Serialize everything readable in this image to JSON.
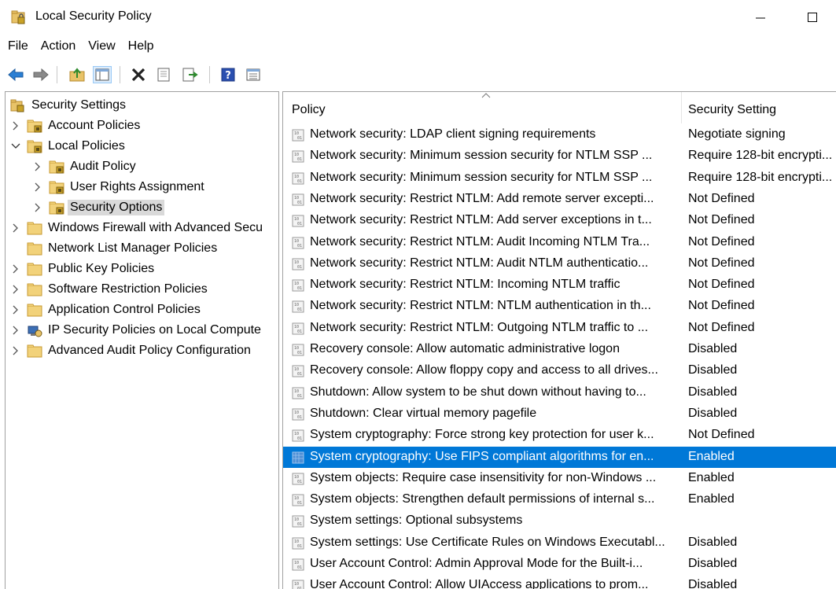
{
  "window": {
    "title": "Local Security Policy"
  },
  "menu": [
    "File",
    "Action",
    "View",
    "Help"
  ],
  "toolbar": {
    "buttons": [
      "back-icon",
      "forward-icon",
      "up-folder-icon",
      "show-hide-tree-icon",
      "delete-icon",
      "properties-icon",
      "export-list-icon",
      "help-icon",
      "view-icon"
    ]
  },
  "tree": {
    "root": "Security Settings",
    "nodes": [
      {
        "label": "Account Policies",
        "level": 1,
        "expander": "collapsed"
      },
      {
        "label": "Local Policies",
        "level": 1,
        "expander": "expanded"
      },
      {
        "label": "Audit Policy",
        "level": 2,
        "expander": "collapsed"
      },
      {
        "label": "User Rights Assignment",
        "level": 2,
        "expander": "collapsed"
      },
      {
        "label": "Security Options",
        "level": 2,
        "expander": "collapsed",
        "selected": true
      },
      {
        "label": "Windows Firewall with Advanced Secu",
        "level": 1,
        "expander": "collapsed"
      },
      {
        "label": "Network List Manager Policies",
        "level": 1,
        "expander": "none"
      },
      {
        "label": "Public Key Policies",
        "level": 1,
        "expander": "collapsed"
      },
      {
        "label": "Software Restriction Policies",
        "level": 1,
        "expander": "collapsed"
      },
      {
        "label": "Application Control Policies",
        "level": 1,
        "expander": "collapsed"
      },
      {
        "label": "IP Security Policies on Local Compute",
        "level": 1,
        "expander": "collapsed",
        "special_icon": true
      },
      {
        "label": "Advanced Audit Policy Configuration",
        "level": 1,
        "expander": "collapsed"
      }
    ]
  },
  "list": {
    "columns": {
      "policy": "Policy",
      "setting": "Security Setting"
    },
    "rows": [
      {
        "policy": "Network security: LDAP client signing requirements",
        "setting": "Negotiate signing"
      },
      {
        "policy": "Network security: Minimum session security for NTLM SSP ...",
        "setting": "Require 128-bit encrypti..."
      },
      {
        "policy": "Network security: Minimum session security for NTLM SSP ...",
        "setting": "Require 128-bit encrypti..."
      },
      {
        "policy": "Network security: Restrict NTLM: Add remote server excepti...",
        "setting": "Not Defined"
      },
      {
        "policy": "Network security: Restrict NTLM: Add server exceptions in t...",
        "setting": "Not Defined"
      },
      {
        "policy": "Network security: Restrict NTLM: Audit Incoming NTLM Tra...",
        "setting": "Not Defined"
      },
      {
        "policy": "Network security: Restrict NTLM: Audit NTLM authenticatio...",
        "setting": "Not Defined"
      },
      {
        "policy": "Network security: Restrict NTLM: Incoming NTLM traffic",
        "setting": "Not Defined"
      },
      {
        "policy": "Network security: Restrict NTLM: NTLM authentication in th...",
        "setting": "Not Defined"
      },
      {
        "policy": "Network security: Restrict NTLM: Outgoing NTLM traffic to ...",
        "setting": "Not Defined"
      },
      {
        "policy": "Recovery console: Allow automatic administrative logon",
        "setting": "Disabled"
      },
      {
        "policy": "Recovery console: Allow floppy copy and access to all drives...",
        "setting": "Disabled"
      },
      {
        "policy": "Shutdown: Allow system to be shut down without having to...",
        "setting": "Disabled"
      },
      {
        "policy": "Shutdown: Clear virtual memory pagefile",
        "setting": "Disabled"
      },
      {
        "policy": "System cryptography: Force strong key protection for user k...",
        "setting": "Not Defined"
      },
      {
        "policy": "System cryptography: Use FIPS compliant algorithms for en...",
        "setting": "Enabled",
        "selected": true
      },
      {
        "policy": "System objects: Require case insensitivity for non-Windows ...",
        "setting": "Enabled"
      },
      {
        "policy": "System objects: Strengthen default permissions of internal s...",
        "setting": "Enabled"
      },
      {
        "policy": "System settings: Optional subsystems",
        "setting": ""
      },
      {
        "policy": "System settings: Use Certificate Rules on Windows Executabl...",
        "setting": "Disabled"
      },
      {
        "policy": "User Account Control: Admin Approval Mode for the Built-i...",
        "setting": "Disabled"
      },
      {
        "policy": "User Account Control: Allow UIAccess applications to prom...",
        "setting": "Disabled"
      }
    ]
  },
  "colors": {
    "selection": "#0078d7",
    "tree_selection": "#d9d9d9",
    "folder": "#e8c368"
  }
}
